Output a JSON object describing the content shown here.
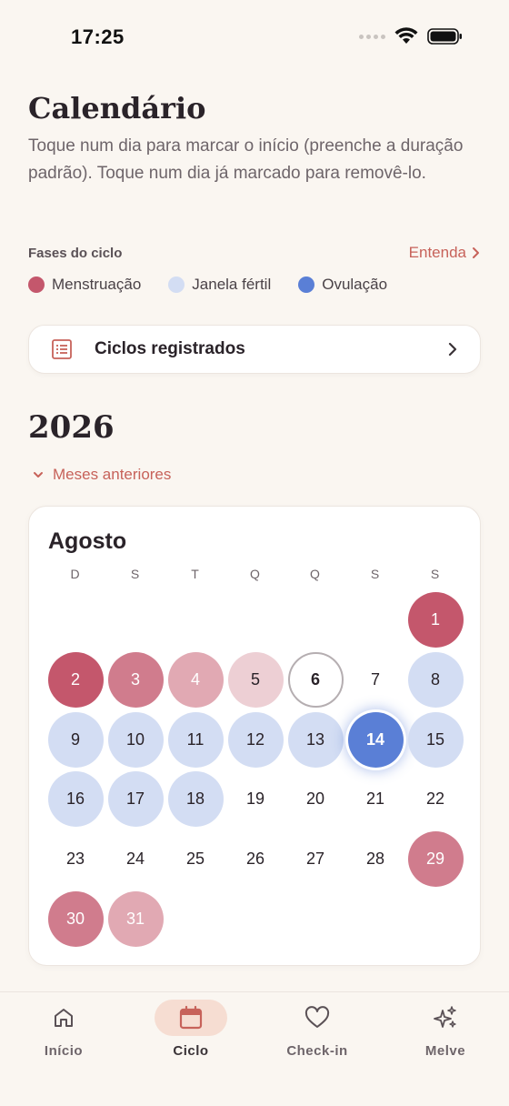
{
  "status_bar": {
    "time": "17:25"
  },
  "header": {
    "title": "Calendário",
    "description": "Toque num dia para marcar o início (preenche a duração padrão). Toque num dia já marcado para removê-lo."
  },
  "phases": {
    "label": "Fases do ciclo",
    "learn_link": "Entenda",
    "legend": [
      {
        "label": "Menstruação",
        "color": "#c4576c"
      },
      {
        "label": "Janela fértil",
        "color": "#d3ddf3"
      },
      {
        "label": "Ovulação",
        "color": "#5a7fd6"
      }
    ]
  },
  "cycles_card": {
    "label": "Ciclos registrados"
  },
  "year": "2026",
  "previous_months": "Meses anteriores",
  "calendar": {
    "month": "Agosto",
    "weekdays": [
      "D",
      "S",
      "T",
      "Q",
      "Q",
      "S",
      "S"
    ],
    "first_weekday_index": 6,
    "days": [
      {
        "n": "1",
        "state": "menst-1"
      },
      {
        "n": "2",
        "state": "menst-1"
      },
      {
        "n": "3",
        "state": "menst-2"
      },
      {
        "n": "4",
        "state": "menst-3"
      },
      {
        "n": "5",
        "state": "menst-4"
      },
      {
        "n": "6",
        "state": "today"
      },
      {
        "n": "7",
        "state": ""
      },
      {
        "n": "8",
        "state": "fertile"
      },
      {
        "n": "9",
        "state": "fertile"
      },
      {
        "n": "10",
        "state": "fertile"
      },
      {
        "n": "11",
        "state": "fertile"
      },
      {
        "n": "12",
        "state": "fertile"
      },
      {
        "n": "13",
        "state": "fertile"
      },
      {
        "n": "14",
        "state": "ovulation"
      },
      {
        "n": "15",
        "state": "fertile"
      },
      {
        "n": "16",
        "state": "fertile"
      },
      {
        "n": "17",
        "state": "fertile"
      },
      {
        "n": "18",
        "state": "fertile"
      },
      {
        "n": "19",
        "state": ""
      },
      {
        "n": "20",
        "state": ""
      },
      {
        "n": "21",
        "state": ""
      },
      {
        "n": "22",
        "state": ""
      },
      {
        "n": "23",
        "state": ""
      },
      {
        "n": "24",
        "state": ""
      },
      {
        "n": "25",
        "state": ""
      },
      {
        "n": "26",
        "state": ""
      },
      {
        "n": "27",
        "state": ""
      },
      {
        "n": "28",
        "state": ""
      },
      {
        "n": "29",
        "state": "menst-2"
      },
      {
        "n": "30",
        "state": "menst-2"
      },
      {
        "n": "31",
        "state": "menst-3"
      }
    ]
  },
  "bottom_nav": {
    "items": [
      {
        "label": "Início",
        "icon": "home-icon",
        "active": false
      },
      {
        "label": "Ciclo",
        "icon": "calendar-icon",
        "active": true
      },
      {
        "label": "Check-in",
        "icon": "heart-icon",
        "active": false
      },
      {
        "label": "Melve",
        "icon": "sparkles-icon",
        "active": false
      }
    ]
  },
  "colors": {
    "accent": "#c7625a",
    "background": "#faf6f1",
    "menstruation": "#c4576c",
    "fertile": "#d3ddf3",
    "ovulation": "#5a7fd6"
  }
}
